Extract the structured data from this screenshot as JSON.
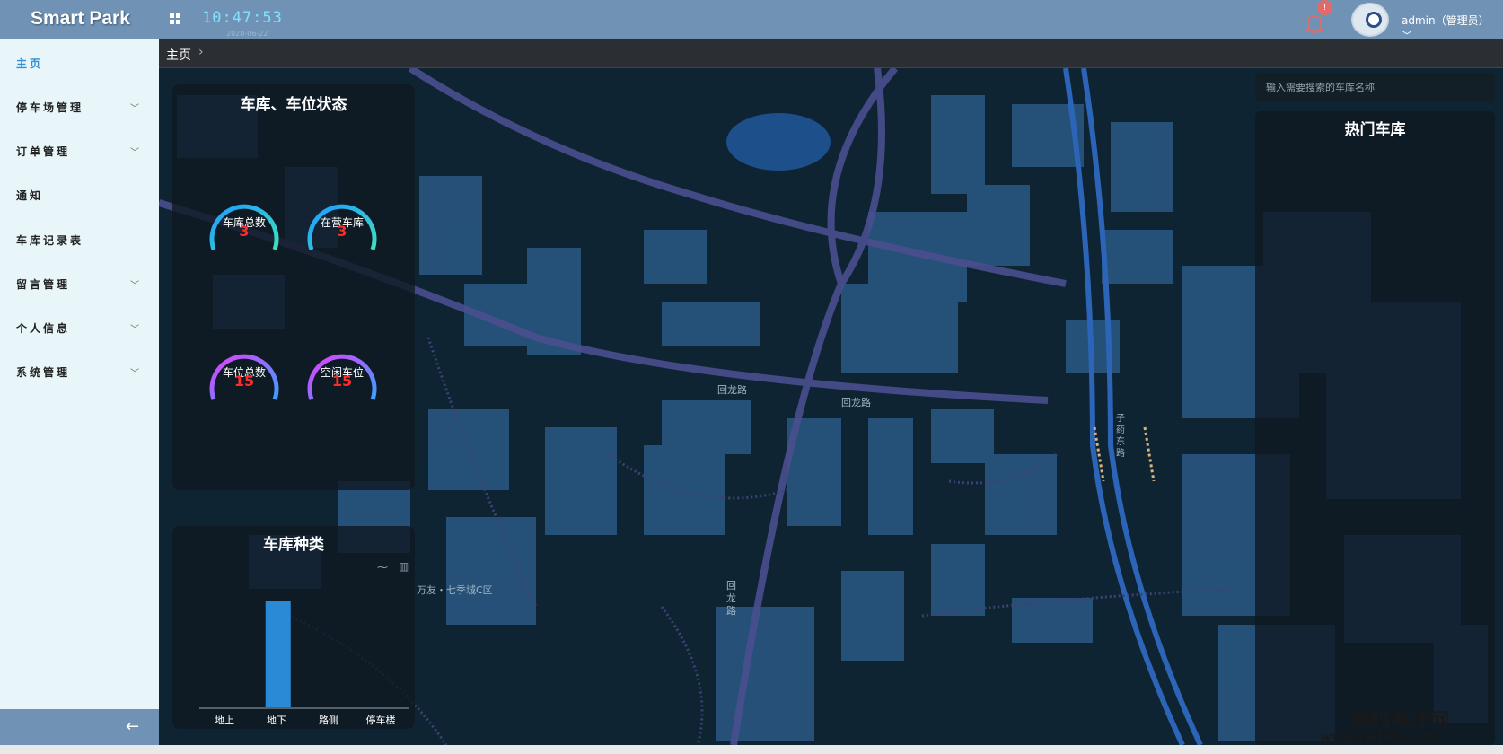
{
  "header": {
    "brand": "Smart Park",
    "time": "10:47:53",
    "date": "2020-06-22",
    "notification_count": "!",
    "user": "admin（管理员）"
  },
  "sidebar": {
    "items": [
      {
        "label": "主页"
      },
      {
        "label": "停车场管理"
      },
      {
        "label": "订单管理"
      },
      {
        "label": "通知"
      },
      {
        "label": "车库记录表"
      },
      {
        "label": "留言管理"
      },
      {
        "label": "个人信息"
      },
      {
        "label": "系统管理"
      }
    ],
    "collapse_icon": "arrow-left-icon"
  },
  "breadcrumb": {
    "current": "主页"
  },
  "status_panel": {
    "title": "车库、车位状态",
    "gauges": [
      {
        "label": "车库总数",
        "value": "3",
        "color_start": "#1e9bff",
        "color_end": "#3fe0c0"
      },
      {
        "label": "在营车库",
        "value": "3",
        "color_start": "#1e9bff",
        "color_end": "#3fe0c0"
      },
      {
        "label": "车位总数",
        "value": "15",
        "color_start": "#e040fb",
        "color_end": "#3aa0ff"
      },
      {
        "label": "空闲车位",
        "value": "15",
        "color_start": "#e040fb",
        "color_end": "#3aa0ff"
      }
    ]
  },
  "type_panel": {
    "title": "车库种类"
  },
  "chart_data": {
    "type": "bar",
    "categories": [
      "地上",
      "地下",
      "路侧",
      "停车楼"
    ],
    "values": [
      0,
      1,
      0,
      0
    ],
    "ylim": [
      0,
      1
    ],
    "color": "#2a8ad6",
    "grid": false
  },
  "search": {
    "placeholder": "输入需要搜索的车库名称"
  },
  "hot_panel": {
    "title": "热门车库"
  },
  "map": {
    "labels": [
      "回龙路",
      "回龙路",
      "万友・七季城C区",
      "回龙路",
      "子药东路"
    ]
  },
  "watermark": {
    "line1": "源码海洋网",
    "line2": "www.codehy.com"
  }
}
